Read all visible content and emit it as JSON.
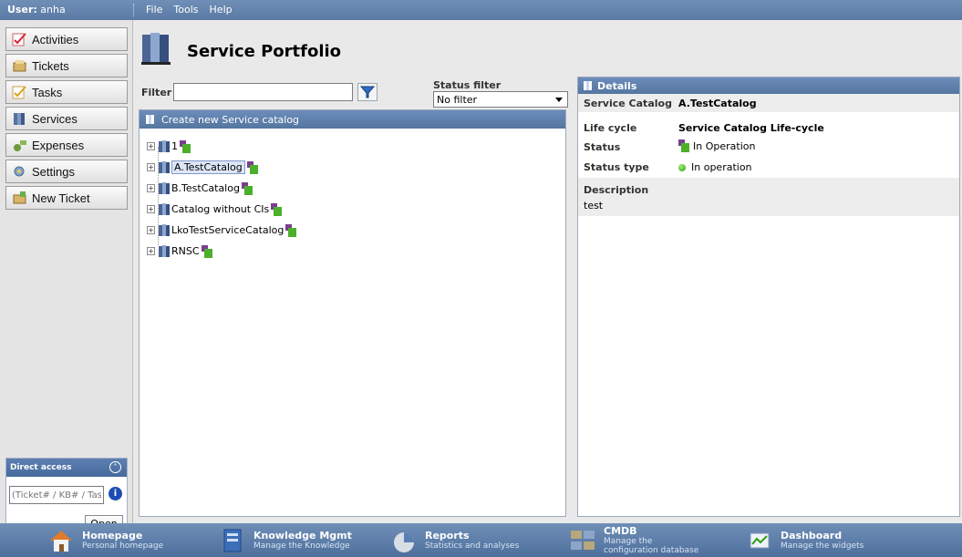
{
  "topbar": {
    "user_label": "User:",
    "user_name": "anha",
    "menu": [
      "File",
      "Tools",
      "Help"
    ]
  },
  "sidebar": {
    "items": [
      {
        "label": "Activities",
        "icon": "activities-icon"
      },
      {
        "label": "Tickets",
        "icon": "tickets-icon"
      },
      {
        "label": "Tasks",
        "icon": "tasks-icon"
      },
      {
        "label": "Services",
        "icon": "services-icon"
      },
      {
        "label": "Expenses",
        "icon": "expenses-icon"
      },
      {
        "label": "Settings",
        "icon": "settings-icon"
      },
      {
        "label": "New Ticket",
        "icon": "new-ticket-icon"
      }
    ],
    "direct_access": {
      "title": "Direct access",
      "placeholder": "(Ticket# / KB# / Task#)",
      "open_label": "Open"
    }
  },
  "page": {
    "title": "Service Portfolio",
    "filter_label": "Filter",
    "filter_value": "",
    "status_filter_label": "Status filter",
    "status_filter_value": "No filter"
  },
  "tree_panel": {
    "header": "Create new Service catalog",
    "nodes": [
      {
        "label": "1",
        "selected": false
      },
      {
        "label": "A.TestCatalog",
        "selected": true
      },
      {
        "label": "B.TestCatalog",
        "selected": false
      },
      {
        "label": "Catalog without CIs",
        "selected": false
      },
      {
        "label": "LkoTestServiceCatalog",
        "selected": false
      },
      {
        "label": "RNSC",
        "selected": false
      }
    ]
  },
  "details": {
    "header": "Details",
    "service_catalog_label": "Service Catalog",
    "service_catalog_value": "A.TestCatalog",
    "life_cycle_label": "Life cycle",
    "life_cycle_value": "Service Catalog Life-cycle",
    "status_label": "Status",
    "status_value": "In Operation",
    "status_type_label": "Status type",
    "status_type_value": "In operation",
    "description_label": "Description",
    "description_value": "test"
  },
  "bottombar": {
    "items": [
      {
        "title": "Homepage",
        "subtitle": "Personal homepage",
        "icon": "home-icon"
      },
      {
        "title": "Knowledge Mgmt",
        "subtitle": "Manage the Knowledge",
        "icon": "knowledge-icon"
      },
      {
        "title": "Reports",
        "subtitle": "Statistics and analyses",
        "icon": "reports-icon"
      },
      {
        "title": "CMDB",
        "subtitle": "Manage the configuration database",
        "icon": "cmdb-icon"
      },
      {
        "title": "Dashboard",
        "subtitle": "Manage the widgets",
        "icon": "dashboard-icon"
      }
    ]
  },
  "colors": {
    "bar_blue": "#5a7aa4",
    "status_green": "#2f9c12",
    "status_purple": "#7a3f8f"
  }
}
